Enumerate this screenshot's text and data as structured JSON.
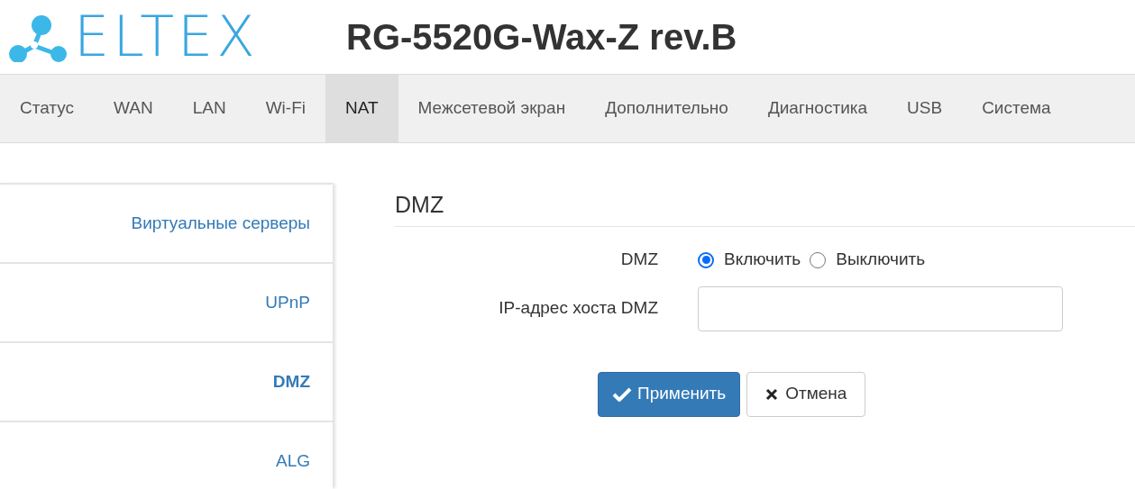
{
  "header": {
    "logo_text": "ELTEX",
    "device_title": "RG-5520G-Wax-Z rev.B"
  },
  "nav_tabs": [
    {
      "label": "Статус",
      "selected": false
    },
    {
      "label": "WAN",
      "selected": false
    },
    {
      "label": "LAN",
      "selected": false
    },
    {
      "label": "Wi-Fi",
      "selected": false
    },
    {
      "label": "NAT",
      "selected": true
    },
    {
      "label": "Межсетевой экран",
      "selected": false
    },
    {
      "label": "Дополнительно",
      "selected": false
    },
    {
      "label": "Диагностика",
      "selected": false
    },
    {
      "label": "USB",
      "selected": false
    },
    {
      "label": "Система",
      "selected": false
    }
  ],
  "sidebar": {
    "items": [
      {
        "label": "Виртуальные серверы",
        "selected": false
      },
      {
        "label": "UPnP",
        "selected": false
      },
      {
        "label": "DMZ",
        "selected": true
      },
      {
        "label": "ALG",
        "selected": false
      }
    ]
  },
  "section": {
    "title": "DMZ",
    "fields": [
      {
        "kind": "radio",
        "label": "DMZ",
        "options": [
          {
            "label": "Включить",
            "selected": true
          },
          {
            "label": "Выключить",
            "selected": false
          }
        ]
      },
      {
        "kind": "text",
        "label": "IP-адрес хоста DMZ"
      }
    ],
    "buttons": [
      {
        "kind": "apply",
        "label": "Применить"
      },
      {
        "kind": "cancel",
        "label": "Отмена"
      }
    ]
  }
}
